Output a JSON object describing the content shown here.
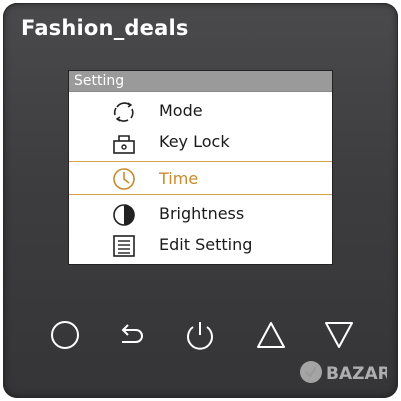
{
  "brand": "Fashion_deals",
  "screen": {
    "title": "Setting",
    "items": [
      {
        "label": "Mode",
        "icon": "mode-icon"
      },
      {
        "label": "Key Lock",
        "icon": "key-lock-icon"
      },
      {
        "label": "Time",
        "icon": "clock-icon",
        "selected": true
      },
      {
        "label": "Brightness",
        "icon": "brightness-icon"
      },
      {
        "label": "Edit Setting",
        "icon": "edit-setting-icon"
      }
    ]
  },
  "buttons": [
    "circle-button",
    "back-button",
    "power-button",
    "up-button",
    "down-button"
  ],
  "watermark": "BAZAR",
  "colors": {
    "body": "#3f3f41",
    "accent": "#c98a2e",
    "title_bar": "#9a9a9a"
  }
}
